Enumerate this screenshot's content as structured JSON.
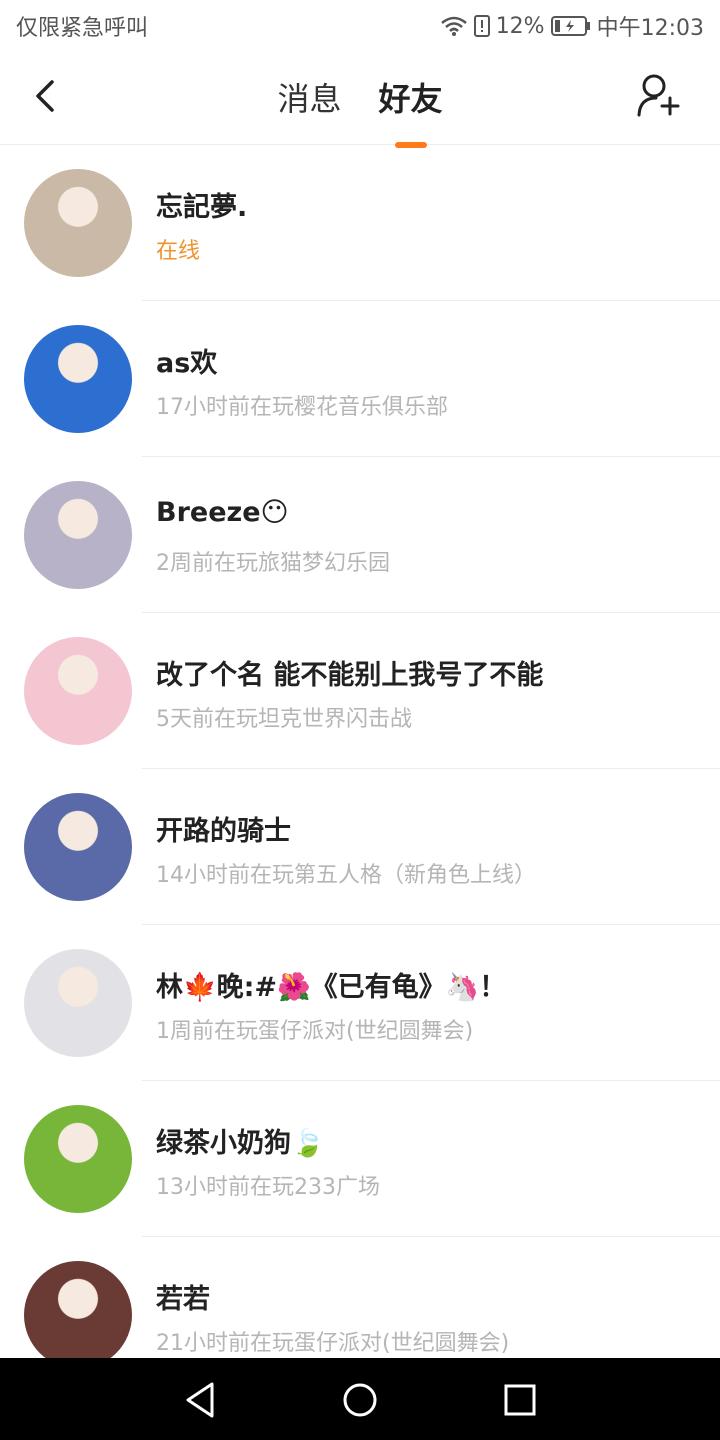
{
  "statusbar": {
    "left_text": "仅限紧急呼叫",
    "battery_percent": "12%",
    "time": "中午12:03"
  },
  "header": {
    "tabs": [
      {
        "label": "消息"
      },
      {
        "label": "好友"
      }
    ],
    "active_tab": "好友"
  },
  "friends": [
    {
      "name": "忘記夢.",
      "status": "在线",
      "avatar_color": "#c9b9a6"
    },
    {
      "name": "as欢",
      "status": "17小时前在玩樱花音乐俱乐部",
      "avatar_color": "#2d6fd0"
    },
    {
      "name": "Breeze😶",
      "status": "2周前在玩旅猫梦幻乐园",
      "avatar_color": "#b7b2c7"
    },
    {
      "name": "改了个名 能不能别上我号了不能",
      "status": "5天前在玩坦克世界闪击战",
      "avatar_color": "#f4c6d2"
    },
    {
      "name": "开路的骑士",
      "status": "14小时前在玩第五人格（新角色上线）",
      "avatar_color": "#5a6aa8"
    },
    {
      "name": "林🍁晚:#🌺《已有龟》🦄！",
      "status": "1周前在玩蛋仔派对(世纪圆舞会)",
      "avatar_color": "#e2e2e6"
    },
    {
      "name": "绿茶小奶狗🍃",
      "status": "13小时前在玩233广场",
      "avatar_color": "#78b63a"
    },
    {
      "name": "若若",
      "status": "21小时前在玩蛋仔派对(世纪圆舞会)",
      "avatar_color": "#6a3b34"
    }
  ],
  "colors": {
    "accent": "#ff7a1a",
    "online": "#f0922e"
  }
}
